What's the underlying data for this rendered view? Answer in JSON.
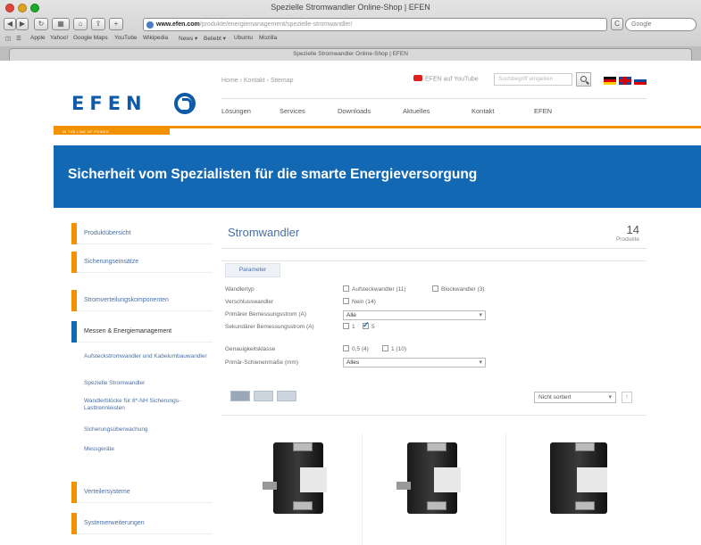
{
  "browser": {
    "window_title": "Spezielle Stromwandler Online-Shop | EFEN",
    "url_domain": "www.efen.com",
    "url_rest": "/produkte/energiemanagement/spezielle-stromwandler/",
    "search_placeholder": "Google",
    "bookmarks": [
      "Apple",
      "Yahoo!",
      "Google Maps",
      "YouTube",
      "Wikipedia",
      "News ▾",
      "Beliebt ▾",
      "Ubuntu",
      "Mozilla"
    ],
    "tab_title": "Spezielle Stromwandler Online-Shop | EFEN"
  },
  "header": {
    "logo_text": "EFEN",
    "breadcrumb": "Home › Kontakt › Sitemap",
    "youtube_label": "EFEN auf YouTube",
    "search_placeholder": "Suchbegriff eingeben",
    "nav": [
      "Lösungen",
      "Services",
      "Downloads",
      "Aktuelles",
      "Kontakt",
      "EFEN"
    ],
    "tagline_tab": "IN THE LINE OF POWER"
  },
  "hero": {
    "headline": "Sicherheit vom Spezialisten für die smarte Energieversorgung"
  },
  "sidebar": {
    "items": [
      {
        "label": "Produktübersicht"
      },
      {
        "label": "Sicherungseinsätze"
      },
      {
        "label": "Stromverteilungskomponenten"
      },
      {
        "label": "Messen & Energiemanagement"
      },
      {
        "label": "Verteilersysteme"
      },
      {
        "label": "Systemerweiterungen"
      }
    ],
    "subitems": [
      "Aufsteckstromwandler und Kabelumbauwandler",
      "Spezielle Stromwandler",
      "Wandlerblöcke für 8*-NH Sicherungs-Lasttrennleisten",
      "Sicherungsüberwachung",
      "Messgeräte"
    ]
  },
  "content": {
    "title": "Stromwandler",
    "count": "14",
    "count_label": "Produkte",
    "param_tab": "Parameter",
    "params": [
      {
        "label": "Wandlertyp",
        "options": [
          {
            "text": "Aufsteckwandler (11)",
            "checked": false
          },
          {
            "text": "Blockwandler (3)",
            "checked": false
          }
        ]
      },
      {
        "label": "Verschlusswandler",
        "options": [
          {
            "text": "Nein (14)",
            "checked": false
          }
        ]
      },
      {
        "label": "Primärer Bemessungsstrom (A)",
        "select": "Alle"
      },
      {
        "label": "Sekundärer Bemessungsstrom (A)",
        "options": [
          {
            "text": "1",
            "checked": false
          },
          {
            "text": "5",
            "checked": true
          }
        ]
      },
      {
        "label": "Genauigkeitsklasse",
        "options": [
          {
            "text": "0,5 (4)",
            "checked": false
          },
          {
            "text": "1 (10)",
            "checked": false
          }
        ]
      },
      {
        "label": "Primär-Schienenmaße (mm)",
        "select": "Alles"
      }
    ],
    "sort_label": "Nicht sortiert",
    "sort_dir": "↑",
    "product_count": 3
  }
}
